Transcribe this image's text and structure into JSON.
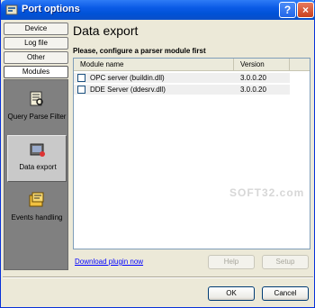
{
  "window": {
    "title": "Port options",
    "help_button": "?",
    "close_button": "×"
  },
  "nav": {
    "buttons": [
      "Device",
      "Log file",
      "Other",
      "Modules"
    ],
    "active": "Modules"
  },
  "modules": [
    {
      "label": "Query Parse Filter",
      "icon": "filter-icon"
    },
    {
      "label": "Data export",
      "icon": "data-export-icon",
      "selected": true
    },
    {
      "label": "Events handling",
      "icon": "events-icon"
    }
  ],
  "main": {
    "title": "Data export",
    "hint": "Please, configure a parser module first",
    "columns": [
      "Module name",
      "Version"
    ],
    "rows": [
      {
        "name": "OPC server (buildin.dll)",
        "version": "3.0.0.20",
        "checked": false
      },
      {
        "name": "DDE Server (ddesrv.dll)",
        "version": "3.0.0.20",
        "checked": false
      }
    ],
    "download_link": "Download plugin now",
    "help_label": "Help",
    "setup_label": "Setup"
  },
  "footer": {
    "ok_label": "OK",
    "cancel_label": "Cancel"
  },
  "watermark": "SOFT32.com"
}
